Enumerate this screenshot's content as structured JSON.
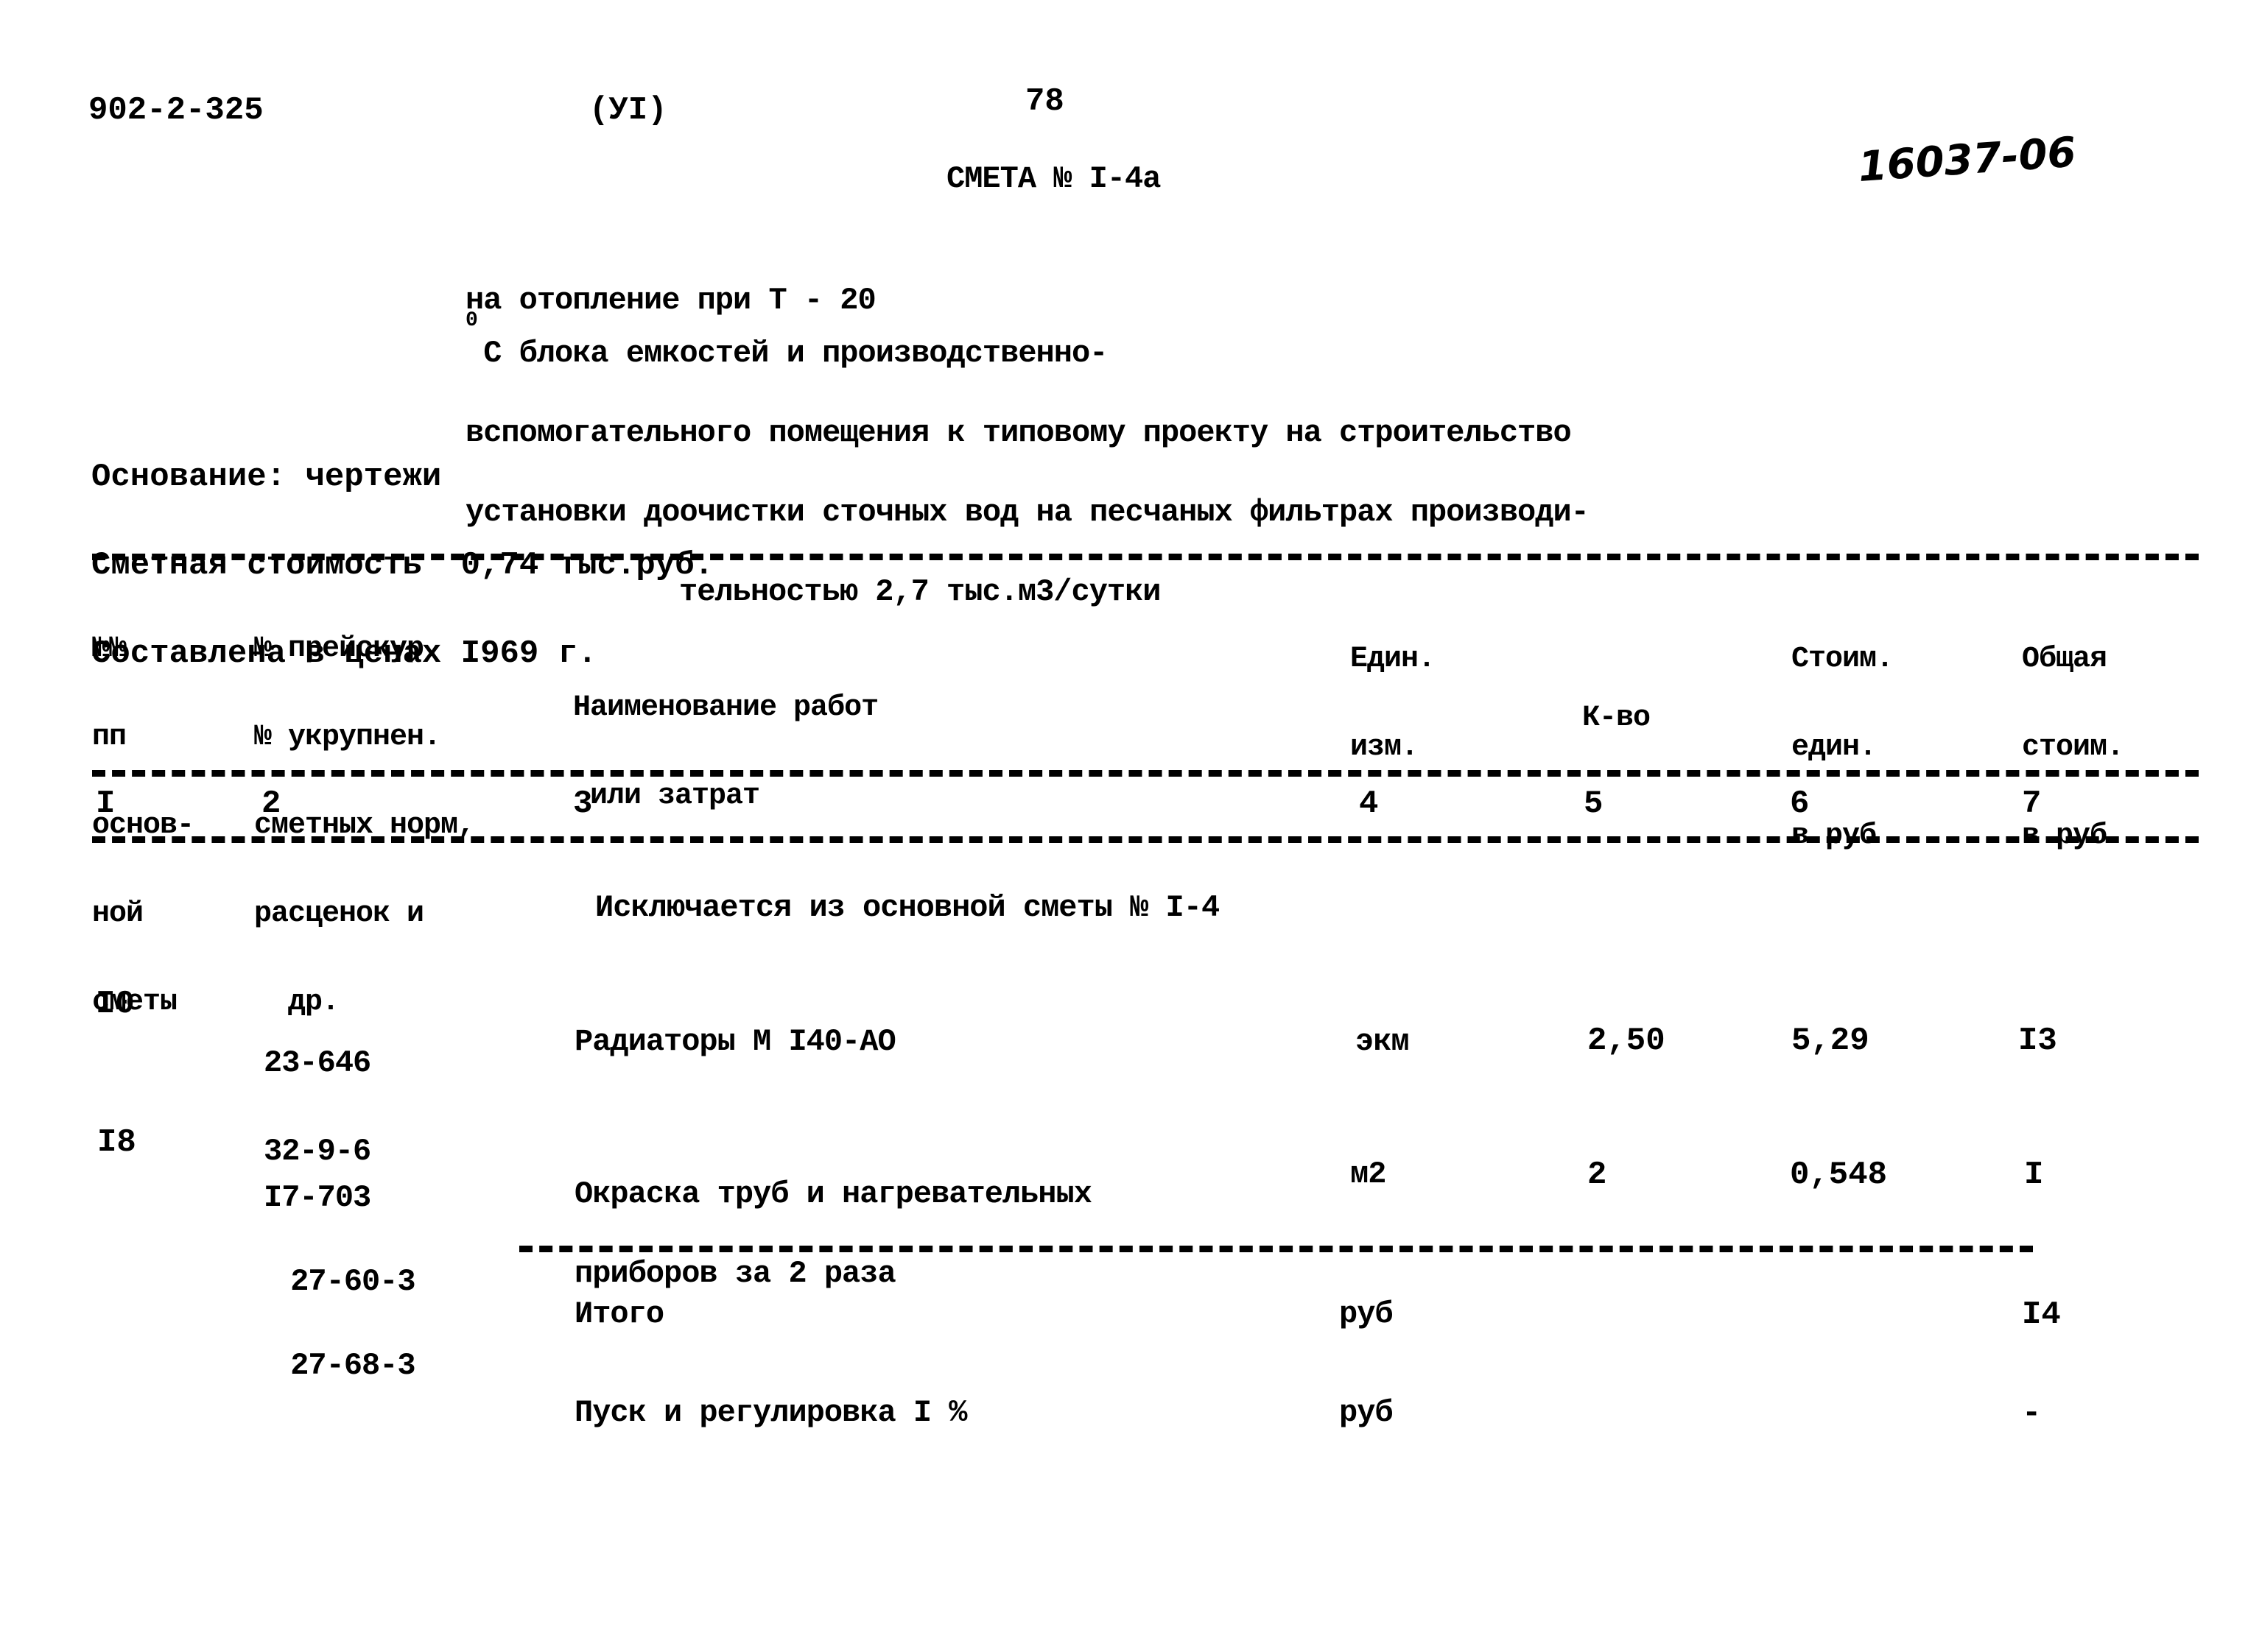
{
  "header": {
    "doc_code": "902-2-325",
    "volume": "(УI)",
    "page_number": "78",
    "title": "СМЕТА № I-4а",
    "handwritten_number": "16037-06"
  },
  "description": {
    "lines": [
      "на отопление при Т - 20",
      "вспомогательного помещения к типовому проекту на строительство",
      "установки доочистки сточных вод на песчаных фильтрах производи-",
      "тельностью 2,7 тыс.м3/сутки"
    ],
    "degree_sup": "0",
    "line1_rest": " С блока емкостей и производственно-"
  },
  "info": {
    "basis": "Основание: чертежи",
    "cost": "Сметная стоимость  0,74 тыс.руб.",
    "prices": "Составлена в ценах I969 г."
  },
  "table": {
    "headers": [
      [
        "№№",
        "пп",
        "основ-",
        "ной",
        "сметы"
      ],
      [
        "№ прейскур.",
        "№ укрупнен.",
        "сметных норм,",
        "расценок и",
        "  др."
      ],
      [
        "",
        "Наименование работ",
        " или затрат"
      ],
      [
        "Един.",
        "изм."
      ],
      [
        "",
        "К-во"
      ],
      [
        "Стоим.",
        "един.",
        "в руб"
      ],
      [
        "Общая",
        "стоим.",
        "в руб"
      ]
    ],
    "column_numbers": [
      "I",
      "2",
      "3",
      "4",
      "5",
      "6",
      "7"
    ],
    "section_title": "Исключается из основной сметы № I-4",
    "rows": [
      {
        "num": "I0",
        "codes": [
          "23-646",
          "32-9-6"
        ],
        "name": [
          "Радиаторы М I40-АО"
        ],
        "unit": "экм",
        "qty": "2,50",
        "unit_cost": "5,29",
        "total": "I3"
      },
      {
        "num": "I8",
        "codes": [
          "I7-703",
          " 27-60-3",
          " 27-68-3"
        ],
        "name": [
          "Окраска труб и нагревательных",
          "приборов за 2 раза"
        ],
        "unit": "м2",
        "qty": "2",
        "unit_cost": "0,548",
        "total": "I"
      }
    ],
    "summary": [
      {
        "label": "Итого",
        "unit": "руб",
        "total": "I4"
      },
      {
        "label": "Пуск и регулировка I %",
        "unit": "руб",
        "total": "-"
      }
    ]
  }
}
